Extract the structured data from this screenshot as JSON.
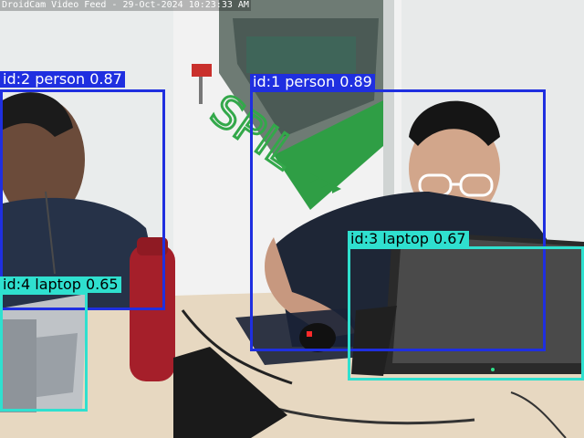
{
  "feed": {
    "title": "DroidCam Video Feed - 29-Oct-2024 10:23:33 AM"
  },
  "colors": {
    "person": "#1f2fe0",
    "laptop": "#2fe0cf",
    "wall": "#e6e6e6",
    "desk": "#e7d8c1",
    "green": "#33a84a"
  },
  "detections": [
    {
      "id": "id:2",
      "class": "person",
      "score": "0.87",
      "label": "id:2 person 0.87"
    },
    {
      "id": "id:1",
      "class": "person",
      "score": "0.89",
      "label": "id:1 person 0.89"
    },
    {
      "id": "id:3",
      "class": "laptop",
      "score": "0.67",
      "label": "id:3 laptop 0.67"
    },
    {
      "id": "id:4",
      "class": "laptop",
      "score": "0.65",
      "label": "id:4 laptop 0.65"
    }
  ],
  "scene_text": {
    "wall_logo": "SPIL"
  }
}
